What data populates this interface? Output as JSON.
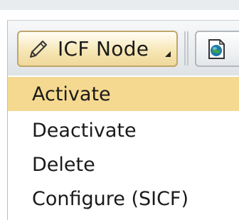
{
  "toolbar": {
    "icf_button_label": "ICF Node",
    "icf_button_icon": "pencil-icon",
    "doc_button_icon": "document-globe-icon"
  },
  "menu": {
    "items": [
      {
        "label": "Activate",
        "highlighted": true
      },
      {
        "label": "Deactivate",
        "highlighted": false
      },
      {
        "label": "Delete",
        "highlighted": false
      },
      {
        "label": "Configure (SICF)",
        "highlighted": false
      }
    ]
  },
  "colors": {
    "highlight": "#f6d990",
    "button_gradient_bottom": "#efd89a",
    "button_border": "#bfa66a",
    "toolbar_background": "#dfe3e6"
  }
}
